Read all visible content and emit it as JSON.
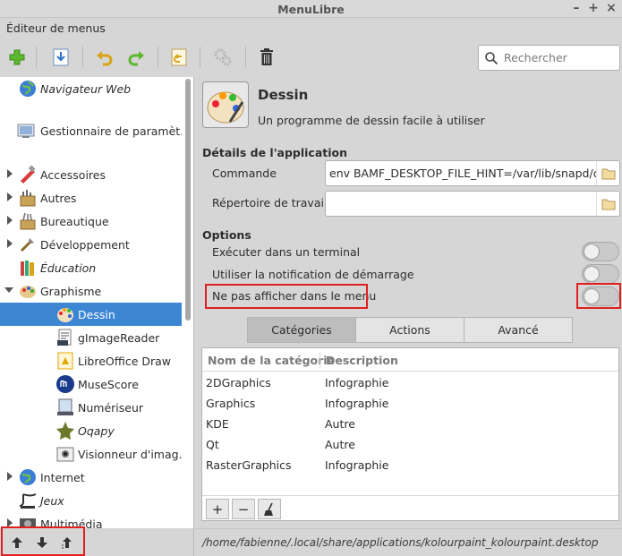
{
  "window": {
    "title": "MenuLibre"
  },
  "menubar": {
    "items": [
      "Éditeur de menus"
    ]
  },
  "search": {
    "placeholder": "Rechercher",
    "value": ""
  },
  "tree": {
    "items": [
      {
        "label": "Navigateur Web",
        "italic": true,
        "icon": "globe-icon"
      },
      {
        "label": "Gestionnaire de paramèt...",
        "italic": false,
        "icon": "settings-manager-icon"
      },
      {
        "label": "Accessoires",
        "italic": false,
        "icon": "accessories-icon"
      },
      {
        "label": "Autres",
        "italic": false,
        "icon": "other-icon"
      },
      {
        "label": "Bureautique",
        "italic": false,
        "icon": "office-icon"
      },
      {
        "label": "Développement",
        "italic": false,
        "icon": "development-icon"
      },
      {
        "label": "Éducation",
        "italic": true,
        "icon": "education-icon"
      },
      {
        "label": "Graphisme",
        "italic": false,
        "icon": "graphics-icon"
      },
      {
        "label": "Dessin",
        "italic": false,
        "icon": "palette-icon"
      },
      {
        "label": "gImageReader",
        "italic": false,
        "icon": "ocr-icon"
      },
      {
        "label": "LibreOffice Draw",
        "italic": false,
        "icon": "draw-icon"
      },
      {
        "label": "MuseScore",
        "italic": false,
        "icon": "musescore-icon"
      },
      {
        "label": "Numériseur",
        "italic": false,
        "icon": "scanner-icon"
      },
      {
        "label": "Oqapy",
        "italic": true,
        "icon": "oqapy-icon"
      },
      {
        "label": "Visionneur d'imag...",
        "italic": false,
        "icon": "image-viewer-icon"
      },
      {
        "label": "Internet",
        "italic": false,
        "icon": "internet-icon"
      },
      {
        "label": "Jeux",
        "italic": true,
        "icon": "games-icon"
      },
      {
        "label": "Multimédia",
        "italic": false,
        "icon": "multimedia-icon"
      }
    ]
  },
  "app": {
    "name": "Dessin",
    "description": "Un programme de dessin facile à utiliser",
    "details_title": "Détails de l'application",
    "command_label": "Commande",
    "command_value": "env BAMF_DESKTOP_FILE_HINT=/var/lib/snapd/deskto",
    "workdir_label": "Répertoire de travail",
    "workdir_value": "",
    "options_title": "Options",
    "options": [
      {
        "label": "Exécuter dans un terminal",
        "on": false
      },
      {
        "label": "Utiliser la notification de démarrage",
        "on": false
      },
      {
        "label": "Ne pas afficher dans le menu",
        "on": false
      }
    ]
  },
  "tabs": [
    "Catégories",
    "Actions",
    "Avancé"
  ],
  "categories": {
    "headers": [
      "Nom de la catégorie",
      "Description"
    ],
    "rows": [
      [
        "2DGraphics",
        "Infographie"
      ],
      [
        "Graphics",
        "Infographie"
      ],
      [
        "KDE",
        "Autre"
      ],
      [
        "Qt",
        "Autre"
      ],
      [
        "RasterGraphics",
        "Infographie"
      ]
    ],
    "buttons": [
      "+",
      "−"
    ]
  },
  "status": {
    "path": "/home/fabienne/.local/share/applications/kolourpaint_kolourpaint.desktop"
  }
}
